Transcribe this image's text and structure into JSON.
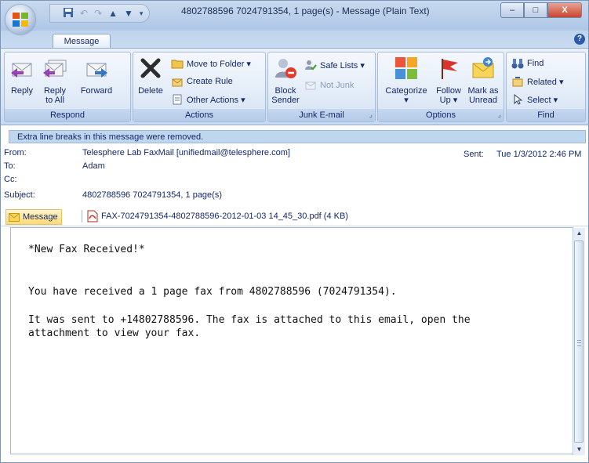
{
  "window": {
    "title": "4802788596 7024791354, 1 page(s) - Message (Plain Text)",
    "minimize": "–",
    "maximize": "□",
    "close": "X"
  },
  "tabs": {
    "message": "Message",
    "help": "?"
  },
  "ribbon": {
    "respond": {
      "label": "Respond",
      "reply": "Reply",
      "reply_all_1": "Reply",
      "reply_all_2": "to All",
      "forward": "Forward"
    },
    "actions": {
      "label": "Actions",
      "delete": "Delete",
      "move_to_folder": "Move to Folder ▾",
      "create_rule": "Create Rule",
      "other_actions": "Other Actions ▾"
    },
    "junk": {
      "label": "Junk E-mail",
      "block_1": "Block",
      "block_2": "Sender",
      "safe_lists": "Safe Lists ▾",
      "not_junk": "Not Junk"
    },
    "options": {
      "label": "Options",
      "categorize_1": "Categorize",
      "categorize_2": "▾",
      "follow_up_1": "Follow",
      "follow_up_2": "Up ▾",
      "mark_as_unread_1": "Mark as",
      "mark_as_unread_2": "Unread"
    },
    "find": {
      "label": "Find",
      "find": "Find",
      "related": "Related ▾",
      "select": "Select ▾"
    }
  },
  "infobar": "Extra line breaks in this message were removed.",
  "header": {
    "from_label": "From:",
    "from_value": "Telesphere Lab FaxMail [unifiedmail@telesphere.com]",
    "to_label": "To:",
    "to_value": "Adam",
    "cc_label": "Cc:",
    "cc_value": "",
    "subject_label": "Subject:",
    "subject_value": "4802788596 7024791354, 1 page(s)",
    "sent_label": "Sent:",
    "sent_value": "Tue 1/3/2012 2:46 PM"
  },
  "attachments": {
    "message_tab": "Message",
    "file": "FAX-7024791354-4802788596-2012-01-03 14_45_30.pdf (4 KB)"
  },
  "body": {
    "line1": "*New Fax Received!*",
    "line2": "You have received a 1 page fax from 4802788596 (7024791354).",
    "line3": "It was sent to +14802788596. The fax is attached to this email, open the",
    "line4": "attachment to view your fax."
  },
  "colors": {
    "ribbon_bg": "#d6e3f3",
    "title_bg": "#c8d9ee",
    "close_btn": "#c8452f",
    "accent_text": "#15286a"
  }
}
